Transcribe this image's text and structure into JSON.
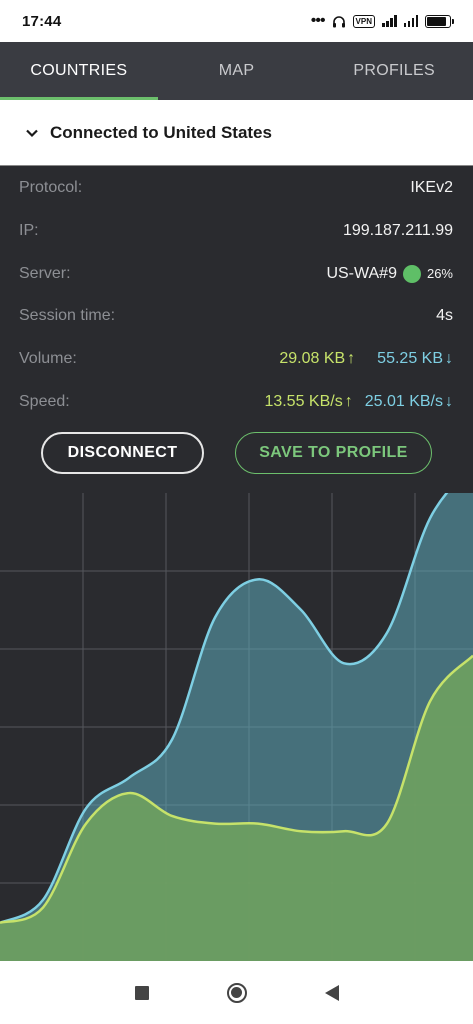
{
  "status_bar": {
    "time": "17:44",
    "dots": "•••",
    "vpn_badge": "VPN",
    "icons": [
      "headset-icon",
      "signal-icon",
      "signal-4g-icon",
      "battery-icon"
    ]
  },
  "tabs": [
    {
      "label": "COUNTRIES",
      "active": true
    },
    {
      "label": "MAP",
      "active": false
    },
    {
      "label": "PROFILES",
      "active": false
    }
  ],
  "connection": {
    "title": "Connected to United States"
  },
  "info": {
    "protocol": {
      "label": "Protocol:",
      "value": "IKEv2"
    },
    "ip": {
      "label": "IP:",
      "value": "199.187.211.99"
    },
    "server": {
      "label": "Server:",
      "value": "US-WA#9",
      "load": "26%"
    },
    "session": {
      "label": "Session time:",
      "value": "4s"
    },
    "volume": {
      "label": "Volume:",
      "up": "29.08 KB",
      "down": "55.25 KB"
    },
    "speed": {
      "label": "Speed:",
      "up": "13.55 KB/s",
      "down": "25.01 KB/s"
    }
  },
  "buttons": {
    "disconnect": "DISCONNECT",
    "save_profile": "SAVE TO PROFILE"
  },
  "colors": {
    "upload": "#c6e26a",
    "download": "#7ecfe3",
    "accent": "#6cbf6c",
    "server_load": "#5fbf67"
  },
  "chart_data": {
    "type": "area",
    "title": "",
    "xlabel": "",
    "ylabel": "",
    "grid": true,
    "ylim": [
      0,
      6
    ],
    "x": [
      0,
      1,
      2,
      3,
      4,
      5,
      6,
      7,
      8,
      9,
      10,
      11
    ],
    "series": [
      {
        "color": "#7ecfe3",
        "values": [
          0.5,
          0.8,
          2.0,
          2.4,
          2.9,
          4.5,
          5.0,
          4.6,
          3.9,
          4.3,
          5.8,
          6.5
        ]
      },
      {
        "color": "#c6e26a",
        "values": [
          0.5,
          0.7,
          1.8,
          2.2,
          1.9,
          1.8,
          1.8,
          1.7,
          1.7,
          1.8,
          3.4,
          4.0
        ]
      }
    ]
  }
}
